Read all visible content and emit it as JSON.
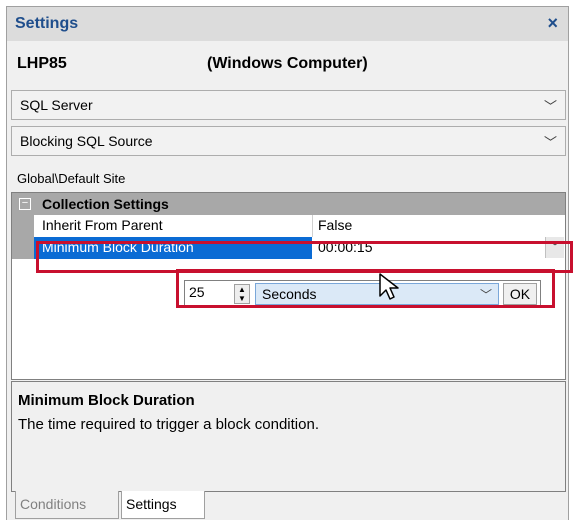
{
  "window": {
    "title": "Settings",
    "close_glyph": "×"
  },
  "host": {
    "name": "LHP85",
    "type": "(Windows Computer)"
  },
  "dropdowns": [
    {
      "value": "SQL Server",
      "arrow": "﹀"
    },
    {
      "value": "Blocking SQL Source",
      "arrow": "﹀"
    }
  ],
  "path": "Global\\Default Site",
  "grid": {
    "category": {
      "label": "Collection Settings",
      "toggle": "−"
    },
    "rows": [
      {
        "name": "Inherit From Parent",
        "value": "False"
      },
      {
        "name": "Minimum Block Duration",
        "value": "00:00:15"
      }
    ],
    "editor": {
      "number": "25",
      "unit": "Seconds",
      "ok_label": "OK",
      "arrow": "﹀",
      "dd_arrow": "﹀"
    }
  },
  "description": {
    "title": "Minimum Block Duration",
    "text": "The time required to trigger a block condition."
  },
  "tabs": [
    {
      "label": "Conditions",
      "active": false
    },
    {
      "label": "Settings",
      "active": true
    }
  ],
  "colors": {
    "selection": "#0a6bd4",
    "highlight": "#c8102e",
    "title": "#1f4e8c"
  }
}
